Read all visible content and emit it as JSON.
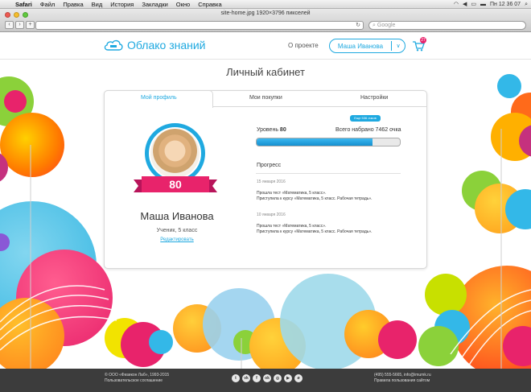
{
  "menubar": {
    "app": "Safari",
    "items": [
      "Файл",
      "Правка",
      "Вид",
      "История",
      "Закладки",
      "Окно",
      "Справка"
    ],
    "clock": "Пн 12 36 07"
  },
  "browser": {
    "window_title": "site-home.jpg 1920×3796 пикселей",
    "search_placeholder": "Google"
  },
  "header": {
    "logo_text": "Облако знаний",
    "about_link": "О проекте",
    "user_name": "Маша Иванова",
    "cart_count": "27"
  },
  "page_title": "Личный кабинет",
  "tabs": [
    {
      "label": "Мой профиль",
      "active": true
    },
    {
      "label": "Мои покупки",
      "active": false
    },
    {
      "label": "Настройки",
      "active": false
    }
  ],
  "profile": {
    "score": "80",
    "name": "Маша Иванова",
    "role": "Ученик, 5 класс",
    "edit_link": "Редактировать"
  },
  "level": {
    "tooltip": "Еще 536 очков",
    "level_label": "Уровень",
    "level_value": "80",
    "total": "Всего набрано 7462 очка",
    "progress_fraction": 0.81
  },
  "progress": {
    "heading": "Прогресс",
    "entries": [
      {
        "date": "15 января 2016",
        "line1": "Прошла тест «Математика, 5 класс».",
        "line2": "Приступила к курсу «Математика, 5 класс. Рабочая тетрадь»."
      },
      {
        "date": "10 января 2016",
        "line1": "Прошла тест «Математика, 5 класс».",
        "line2": "Приступила к курсу «Математика, 5 класс. Рабочая тетрадь»."
      }
    ]
  },
  "footer": {
    "copyright": "© ООО «Физикон Лаб», 1993-2015",
    "agreement": "Пользовательское соглашение",
    "contacts": "(495) 555-5665, info@imumk.ru",
    "rules": "Правила пользования сайтом",
    "social_icons": [
      "twitter-icon",
      "vk-icon",
      "facebook-icon",
      "odnoklassniki-icon",
      "instagram-icon",
      "youtube-icon",
      "odnoklassniki-alt-icon"
    ]
  },
  "colors": {
    "accent": "#1fa9e0",
    "pink": "#e8236b",
    "footer": "#3c3c3c"
  }
}
